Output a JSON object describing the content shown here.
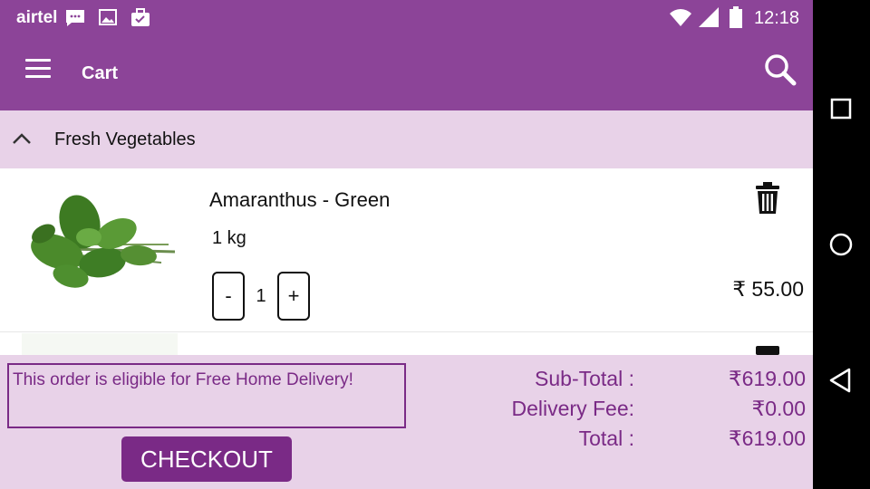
{
  "status_bar": {
    "carrier": "airtel",
    "time": "12:18",
    "icons": [
      "message-icon",
      "image-icon",
      "briefcase-icon",
      "wifi-icon",
      "signal-icon",
      "battery-icon"
    ]
  },
  "app_bar": {
    "title": "Cart",
    "menu_icon": "hamburger-menu-icon",
    "search_icon": "search-icon"
  },
  "category": {
    "name": "Fresh Vegetables",
    "expanded": true
  },
  "cart_items": [
    {
      "name": "Amaranthus - Green",
      "unit": "1 kg",
      "quantity": "1",
      "price": "₹ 55.00",
      "minus_label": "-",
      "plus_label": "+"
    }
  ],
  "summary": {
    "notice": "This order is eligible for Free Home Delivery!",
    "subtotal_label": "Sub-Total :",
    "subtotal_value": "₹619.00",
    "delivery_label": "Delivery Fee:",
    "delivery_value": "₹0.00",
    "total_label": "Total :",
    "total_value": "₹619.00",
    "checkout_label": "CHECKOUT"
  },
  "colors": {
    "primary": "#8c4498",
    "primary_dark": "#7a2a86",
    "panel": "#e8d2e8"
  }
}
